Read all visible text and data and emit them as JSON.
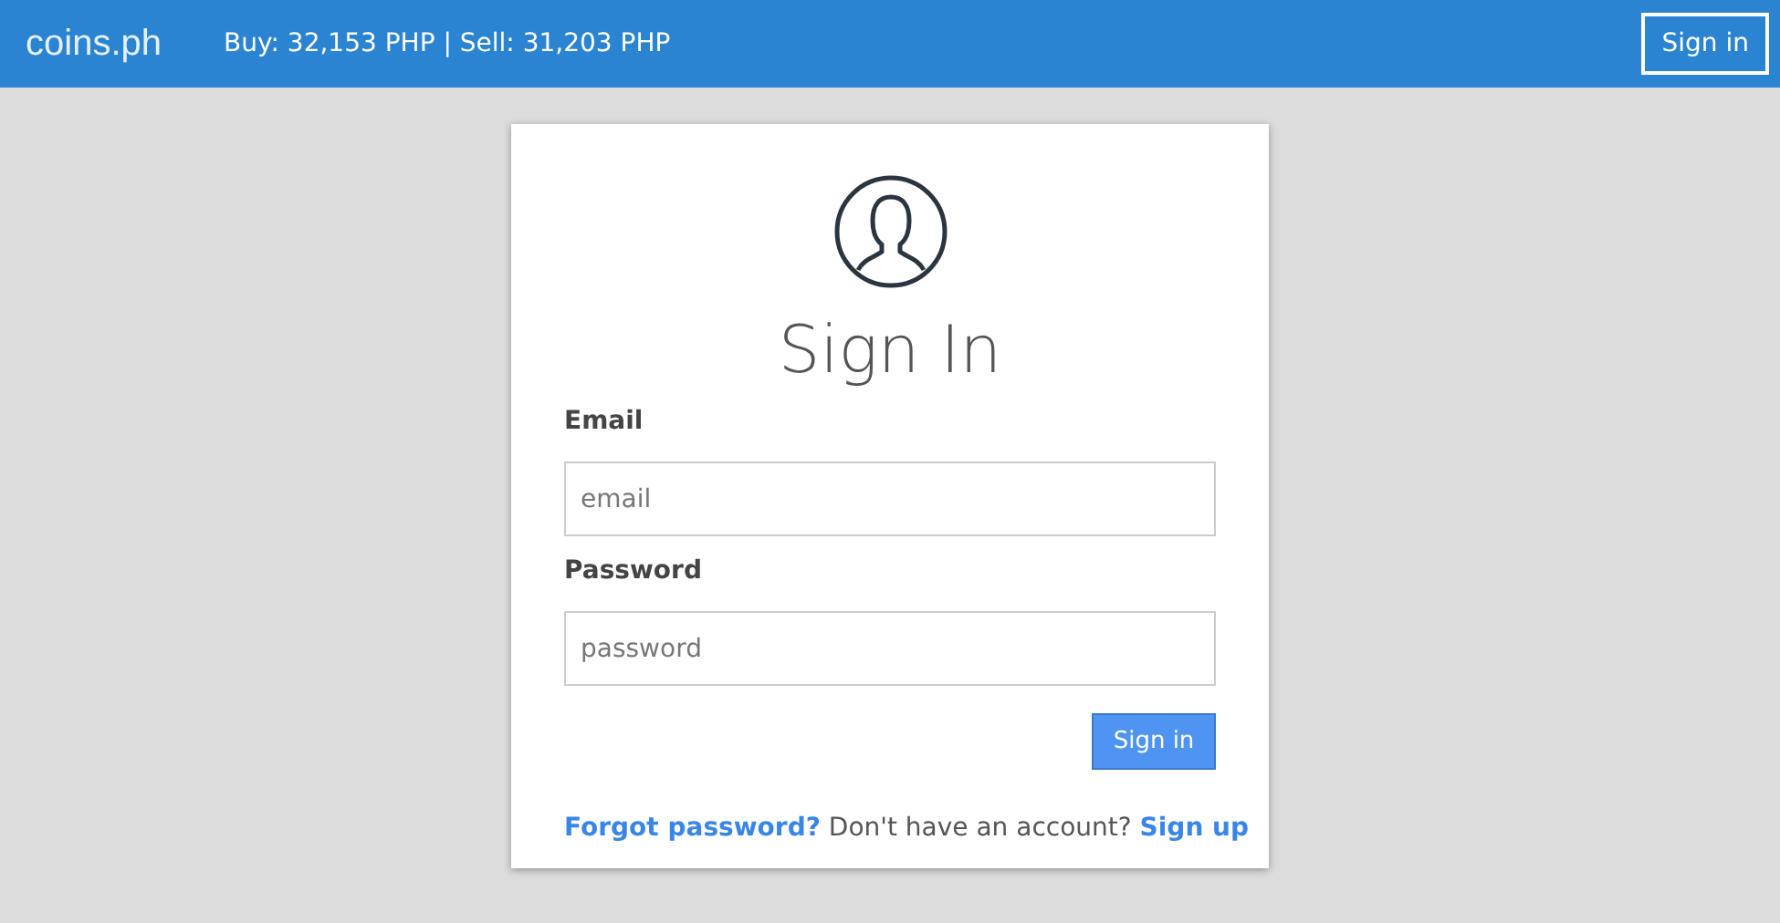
{
  "header": {
    "logo": "coins.ph",
    "rates": "Buy: 32,153 PHP | Sell: 31,203 PHP",
    "sign_in_button": "Sign in"
  },
  "form": {
    "title": "Sign In",
    "fields": [
      {
        "label": "Email",
        "placeholder": "email"
      },
      {
        "label": "Password",
        "placeholder": "password"
      }
    ],
    "submit": "Sign in",
    "forgot_link": "Forgot password?",
    "signup_prompt": "Don't have an account?",
    "signup_link": "Sign up"
  }
}
